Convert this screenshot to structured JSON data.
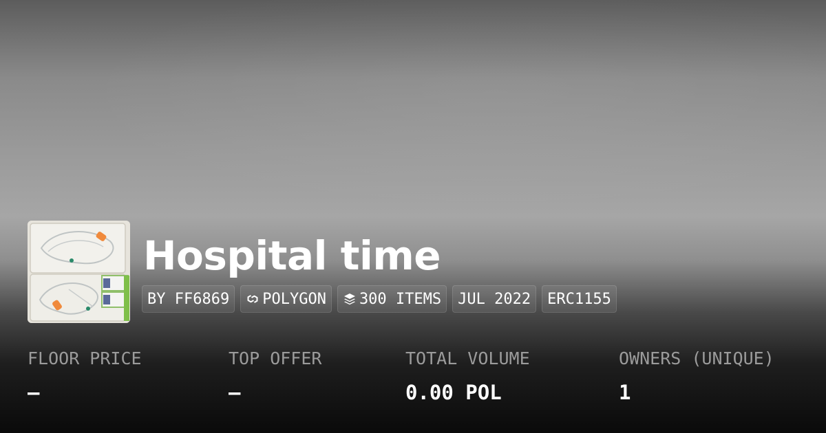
{
  "collection": {
    "title": "Hospital time"
  },
  "chips": {
    "creator": "BY FF6869",
    "chain": "POLYGON",
    "items": "300 ITEMS",
    "date": "JUL 2022",
    "standard": "ERC1155"
  },
  "stats": {
    "floor_price": {
      "label": "FLOOR PRICE",
      "value": "—"
    },
    "top_offer": {
      "label": "TOP OFFER",
      "value": "—"
    },
    "total_volume": {
      "label": "TOTAL VOLUME",
      "value": "0.00 POL"
    },
    "owners": {
      "label": "OWNERS (UNIQUE)",
      "value": "1"
    }
  },
  "icons": {
    "chain": "polygon-link-icon",
    "items": "layers-icon"
  }
}
